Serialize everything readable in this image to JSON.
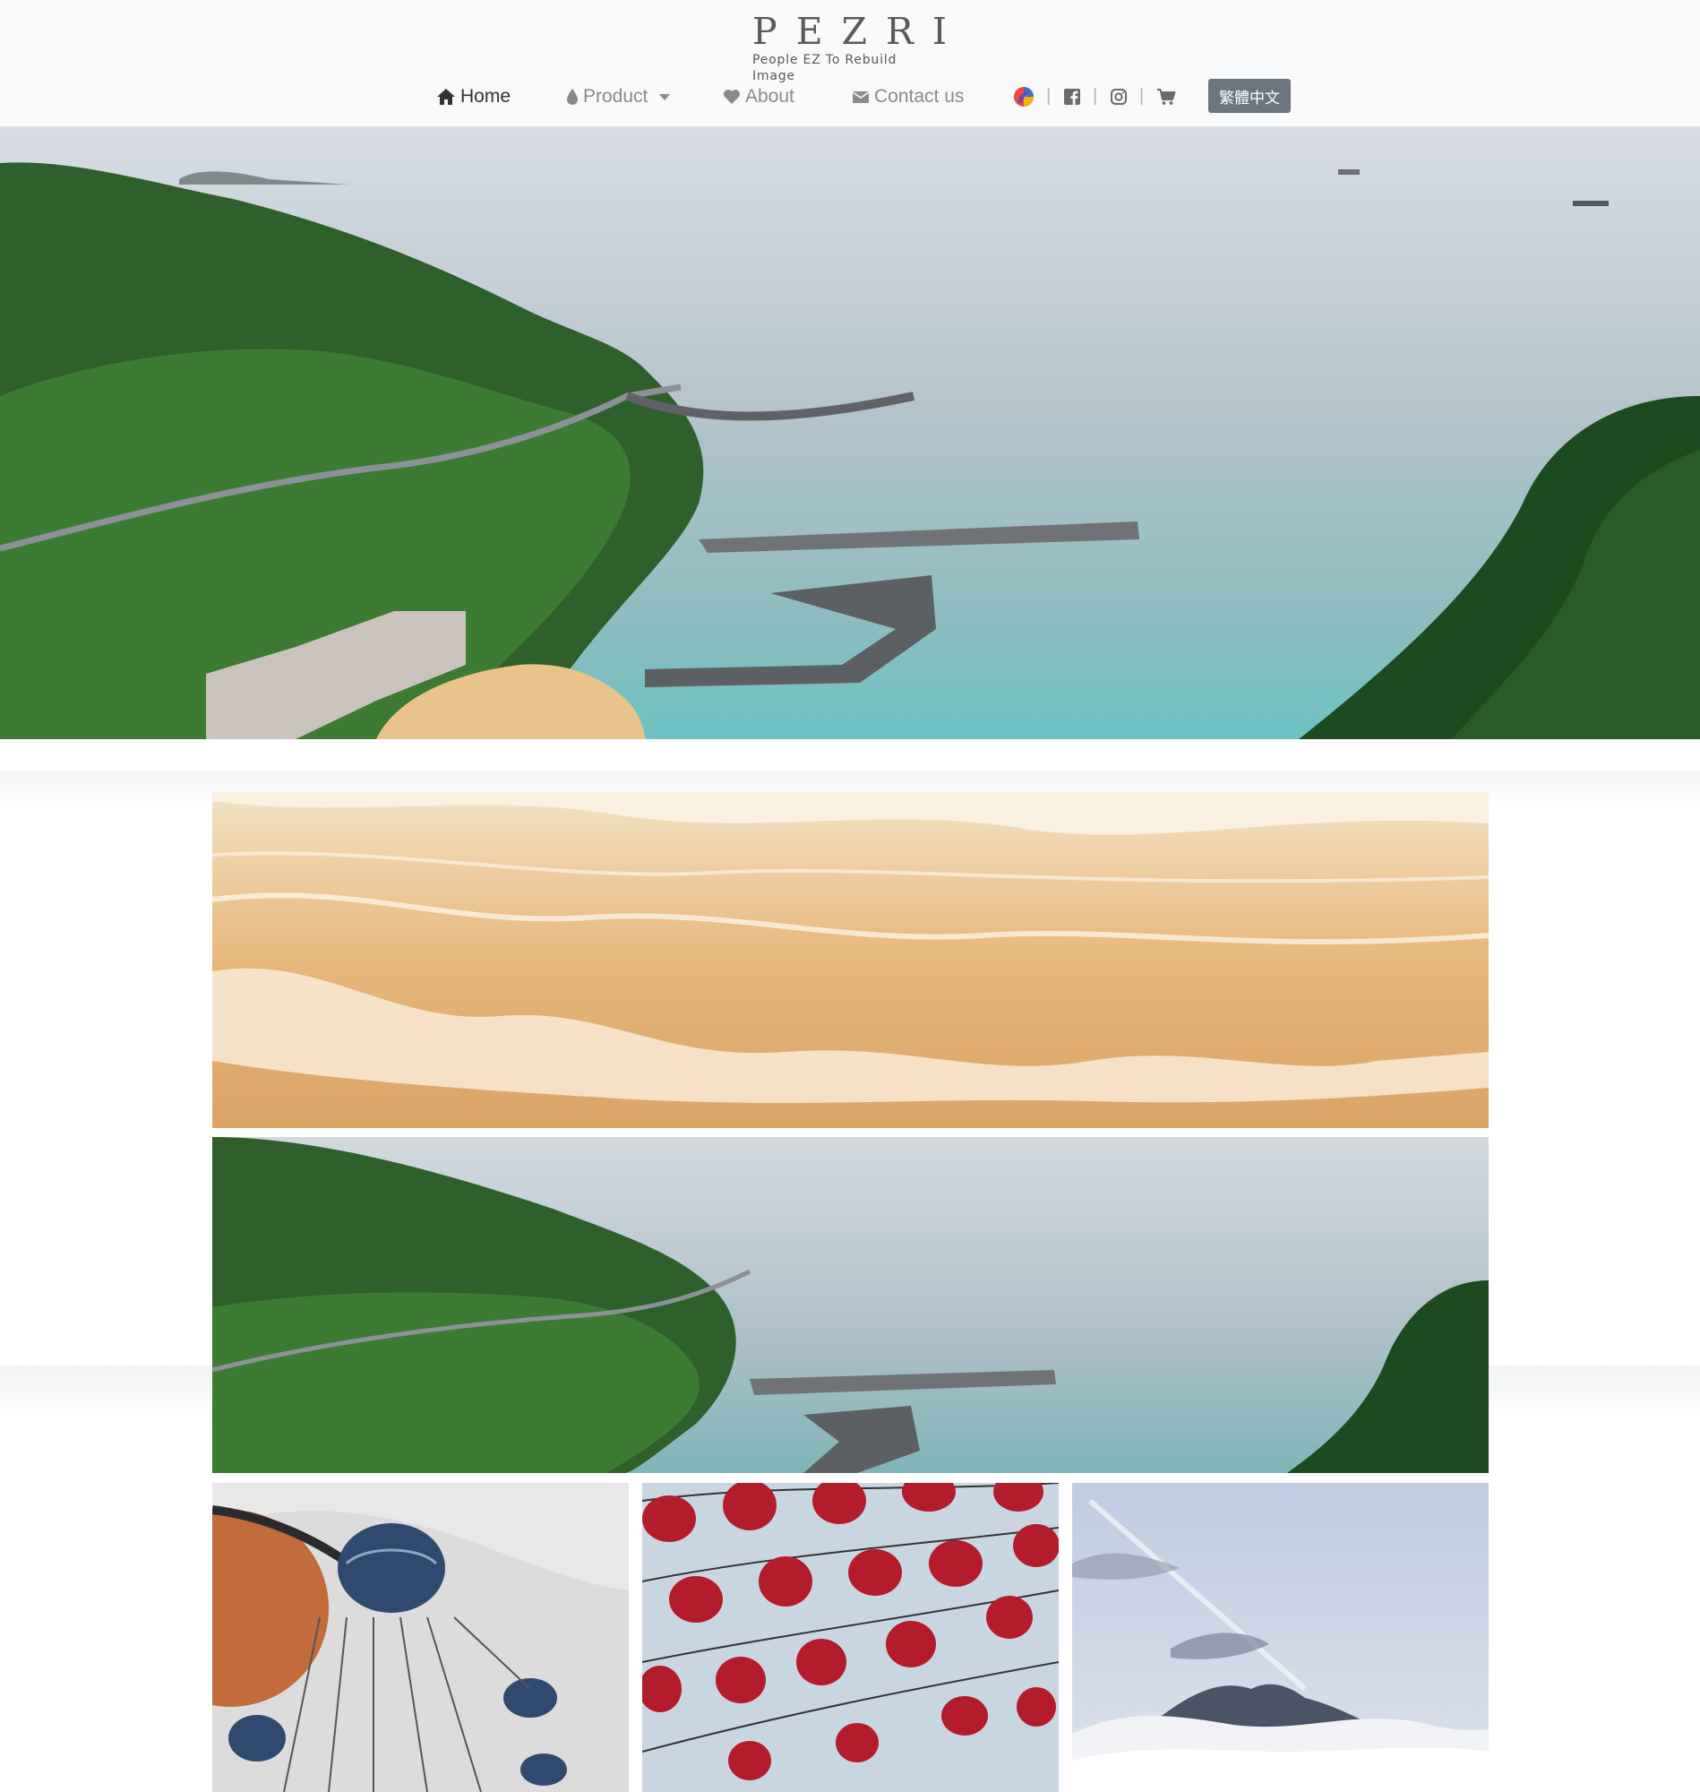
{
  "brand": {
    "name": "PEZRI",
    "tagline": "People EZ To Rebuild Image"
  },
  "nav": {
    "home": "Home",
    "product": "Product",
    "about": "About",
    "contact": "Contact us",
    "separator": "|",
    "language_button": "繁體中文"
  },
  "icons": {
    "home": "home-icon",
    "product": "droplet-icon",
    "about": "heart-icon",
    "contact": "envelope-icon",
    "brand_badge": "colorful-circle-icon",
    "facebook": "facebook-icon",
    "instagram": "instagram-icon",
    "cart": "cart-icon"
  },
  "hero": {
    "slide_count": 3,
    "active_slide": 2,
    "caption": ""
  },
  "colors": {
    "header_bg": "#f8f9fa",
    "nav_text": "#8a8a8a",
    "nav_active": "#333333",
    "language_button_bg": "#6c757d"
  }
}
